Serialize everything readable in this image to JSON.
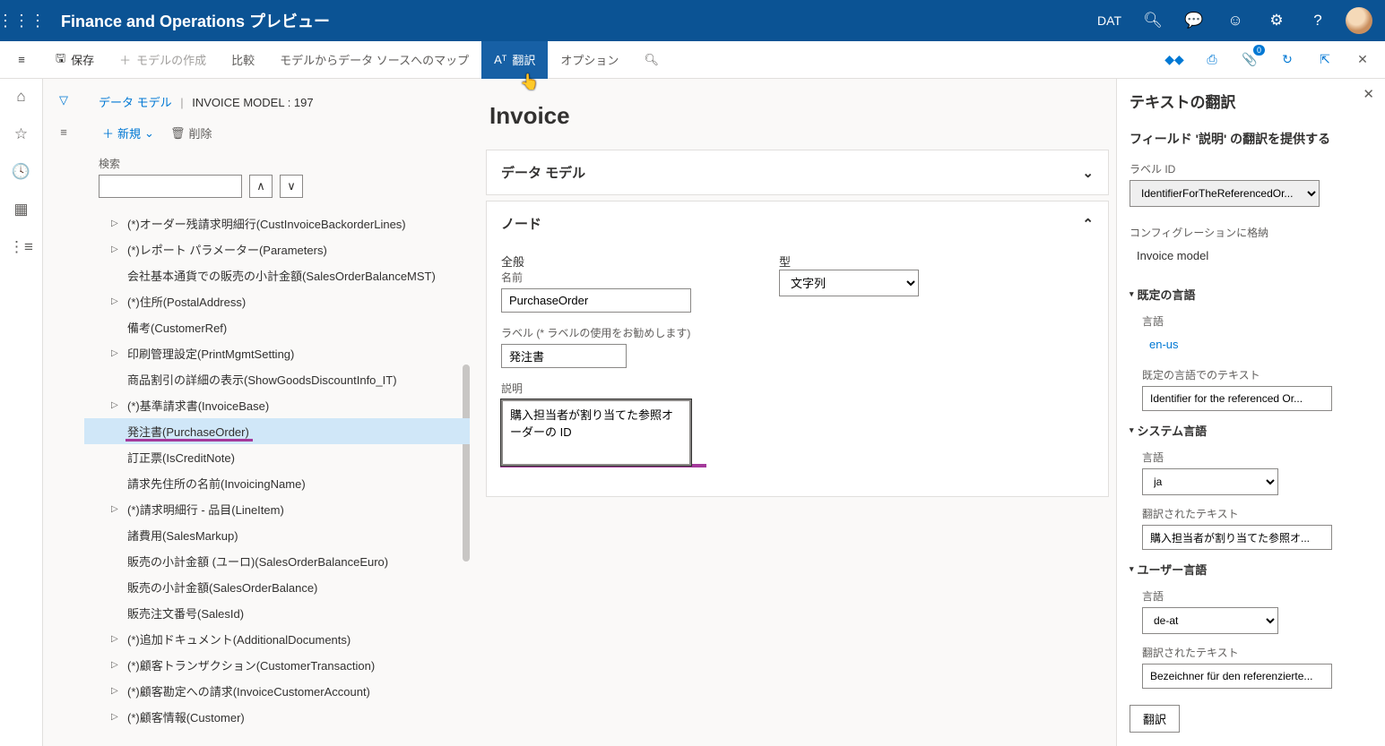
{
  "header": {
    "title": "Finance and Operations プレビュー",
    "company": "DAT"
  },
  "commandBar": {
    "save": "保存",
    "createModel": "モデルの作成",
    "compare": "比較",
    "mapModel": "モデルからデータ ソースへのマップ",
    "translate": "翻訳",
    "options": "オプション",
    "badgeCount": "0"
  },
  "breadcrumb": {
    "root": "データ モデル",
    "current": "INVOICE MODEL : 197"
  },
  "treeToolbar": {
    "new": "新規",
    "delete": "削除"
  },
  "search": {
    "label": "検索"
  },
  "treeItems": [
    {
      "label": "(*)オーダー残請求明細行(CustInvoiceBackorderLines)",
      "expandable": true
    },
    {
      "label": "(*)レポート パラメーター(Parameters)",
      "expandable": true
    },
    {
      "label": "会社基本通貨での販売の小計金額(SalesOrderBalanceMST)",
      "expandable": false
    },
    {
      "label": "(*)住所(PostalAddress)",
      "expandable": true
    },
    {
      "label": "備考(CustomerRef)",
      "expandable": false
    },
    {
      "label": "印刷管理設定(PrintMgmtSetting)",
      "expandable": true
    },
    {
      "label": "商品割引の詳細の表示(ShowGoodsDiscountInfo_IT)",
      "expandable": false
    },
    {
      "label": "(*)基準請求書(InvoiceBase)",
      "expandable": true
    },
    {
      "label": "発注書(PurchaseOrder)",
      "expandable": false,
      "selected": true
    },
    {
      "label": "訂正票(IsCreditNote)",
      "expandable": false
    },
    {
      "label": "請求先住所の名前(InvoicingName)",
      "expandable": false
    },
    {
      "label": "(*)請求明細行 - 品目(LineItem)",
      "expandable": true
    },
    {
      "label": "諸費用(SalesMarkup)",
      "expandable": false
    },
    {
      "label": "販売の小計金額 (ユーロ)(SalesOrderBalanceEuro)",
      "expandable": false
    },
    {
      "label": "販売の小計金額(SalesOrderBalance)",
      "expandable": false
    },
    {
      "label": "販売注文番号(SalesId)",
      "expandable": false
    },
    {
      "label": "(*)追加ドキュメント(AdditionalDocuments)",
      "expandable": true
    },
    {
      "label": "(*)顧客トランザクション(CustomerTransaction)",
      "expandable": true
    },
    {
      "label": "(*)顧客勘定への請求(InvoiceCustomerAccount)",
      "expandable": true
    },
    {
      "label": "(*)顧客情報(Customer)",
      "expandable": true
    }
  ],
  "detail": {
    "heading": "Invoice",
    "sectionDataModel": "データ モデル",
    "sectionNode": "ノード",
    "general": "全般",
    "type": "型",
    "typeValue": "文字列",
    "nameLabel": "名前",
    "nameValue": "PurchaseOrder",
    "labelLabel": "ラベル (* ラベルの使用をお勧めします)",
    "labelValue": "発注書",
    "descLabel": "説明",
    "descValue": "購入担当者が割り当てた参照オーダーの ID"
  },
  "sidePanel": {
    "title": "テキストの翻訳",
    "subtitle": "フィールド '説明' の翻訳を提供する",
    "labelIdLabel": "ラベル ID",
    "labelIdValue": "IdentifierForTheReferencedOr...",
    "storedInLabel": "コンフィグレーションに格納",
    "storedInValue": "Invoice model",
    "defaultLang": {
      "heading": "既定の言語",
      "langLabel": "言語",
      "langValue": "en-us",
      "textLabel": "既定の言語でのテキスト",
      "textValue": "Identifier for the referenced Or..."
    },
    "systemLang": {
      "heading": "システム言語",
      "langLabel": "言語",
      "langValue": "ja",
      "textLabel": "翻訳されたテキスト",
      "textValue": "購入担当者が割り当てた参照オ..."
    },
    "userLang": {
      "heading": "ユーザー言語",
      "langLabel": "言語",
      "langValue": "de-at",
      "textLabel": "翻訳されたテキスト",
      "textValue": "Bezeichner für den referenzierte..."
    },
    "translateBtn": "翻訳"
  }
}
